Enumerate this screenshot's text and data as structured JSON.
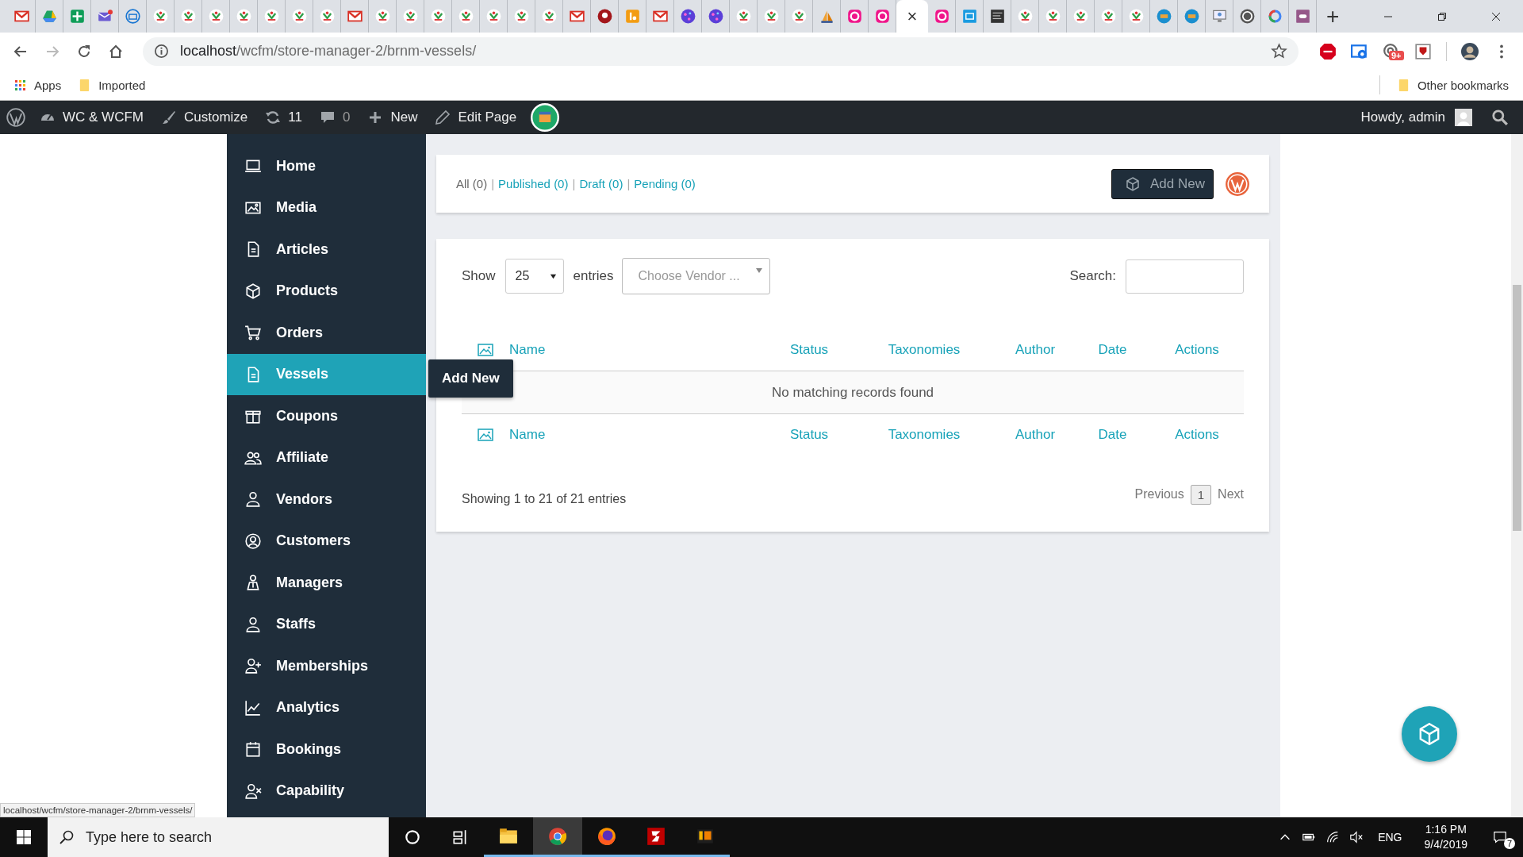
{
  "browser": {
    "tabs": [
      {
        "selected": false
      },
      {
        "selected": false
      },
      {
        "selected": false
      },
      {
        "selected": false
      },
      {
        "selected": false
      },
      {
        "selected": false
      },
      {
        "selected": false
      },
      {
        "selected": false
      },
      {
        "selected": false
      },
      {
        "selected": false
      },
      {
        "selected": false
      },
      {
        "selected": false
      },
      {
        "selected": false
      },
      {
        "selected": false
      },
      {
        "selected": false
      },
      {
        "selected": false
      },
      {
        "selected": false
      },
      {
        "selected": false
      },
      {
        "selected": false
      },
      {
        "selected": false
      },
      {
        "selected": false
      },
      {
        "selected": false
      },
      {
        "selected": false
      },
      {
        "selected": false
      },
      {
        "selected": false
      },
      {
        "selected": false
      },
      {
        "selected": false
      },
      {
        "selected": false
      },
      {
        "selected": false
      },
      {
        "selected": false
      },
      {
        "selected": false
      },
      {
        "selected": false
      },
      {
        "selected": true
      },
      {
        "selected": false
      },
      {
        "selected": false
      },
      {
        "selected": false
      },
      {
        "selected": false
      },
      {
        "selected": false
      },
      {
        "selected": false
      },
      {
        "selected": false
      },
      {
        "selected": false
      },
      {
        "selected": false
      },
      {
        "selected": false
      },
      {
        "selected": false
      },
      {
        "selected": false
      },
      {
        "selected": false
      },
      {
        "selected": false
      }
    ],
    "close_tab": "×",
    "new_tab": "+",
    "url_host": "localhost",
    "url_path": "/wcfm/store-manager-2/brnm-vessels/",
    "extension_badge": "9+",
    "bookmarks": [
      "Apps",
      "Imported"
    ],
    "other_bookmarks": "Other bookmarks"
  },
  "admin_bar": {
    "items": [
      "WC & WCFM",
      "Customize",
      "11",
      "0",
      "New",
      "Edit Page"
    ],
    "greeting": "Howdy, admin"
  },
  "sidebar": {
    "items": [
      {
        "label": "Home",
        "selected": false
      },
      {
        "label": "Media",
        "selected": false
      },
      {
        "label": "Articles",
        "selected": false
      },
      {
        "label": "Products",
        "selected": false
      },
      {
        "label": "Orders",
        "selected": false
      },
      {
        "label": "Vessels",
        "selected": true
      },
      {
        "label": "Coupons",
        "selected": false
      },
      {
        "label": "Affiliate",
        "selected": false
      },
      {
        "label": "Vendors",
        "selected": false
      },
      {
        "label": "Customers",
        "selected": false
      },
      {
        "label": "Managers",
        "selected": false
      },
      {
        "label": "Staffs",
        "selected": false
      },
      {
        "label": "Memberships",
        "selected": false
      },
      {
        "label": "Analytics",
        "selected": false
      },
      {
        "label": "Bookings",
        "selected": false
      },
      {
        "label": "Capability",
        "selected": false
      }
    ]
  },
  "tooltip": "Add New",
  "filters": [
    {
      "label": "All (0)",
      "selected": true
    },
    {
      "label": "Published (0)",
      "selected": false
    },
    {
      "label": "Draft (0)",
      "selected": false
    },
    {
      "label": "Pending (0)",
      "selected": false
    }
  ],
  "filter_separator": "|",
  "add_new_button": "Add New",
  "table": {
    "show_label": "Show",
    "page_size": "25",
    "entries_label": "entries",
    "vendor_placeholder": "Choose Vendor ...",
    "search_label": "Search:",
    "columns": [
      "Name",
      "Status",
      "Taxonomies",
      "Author",
      "Date",
      "Actions"
    ],
    "footer_columns": [
      "Name",
      "Status",
      "Taxonomies",
      "Author",
      "Date",
      "Actions"
    ],
    "empty_message": "No matching records found",
    "info": "Showing 1 to 21 of 21 entries",
    "previous": "Previous",
    "pages": [
      {
        "label": "1",
        "selected": true
      }
    ],
    "next": "Next"
  },
  "status_url": "localhost/wcfm/store-manager-2/brnm-vessels/",
  "taskbar": {
    "search_placeholder": "Type here to search",
    "apps": [
      {
        "selected": false
      },
      {
        "selected": true
      },
      {
        "selected": false
      },
      {
        "selected": false
      },
      {
        "selected": false
      }
    ],
    "language": "ENG",
    "time": "1:16 PM",
    "date": "9/4/2019",
    "notifications": "7"
  }
}
